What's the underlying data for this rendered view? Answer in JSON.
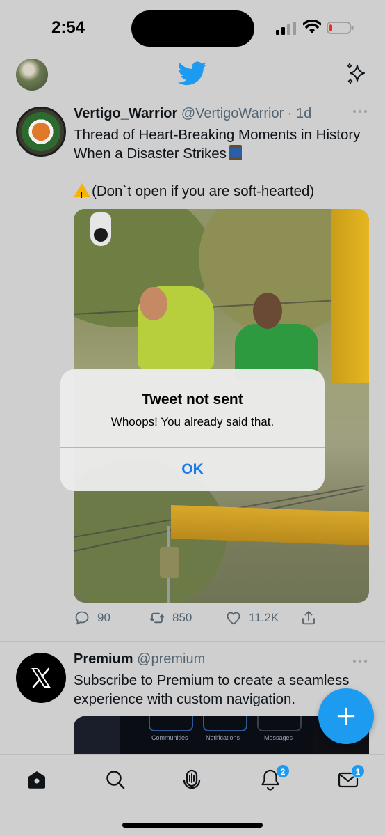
{
  "status_bar": {
    "time": "2:54",
    "battery_level": 0.15,
    "battery_color": "#e0312f"
  },
  "top_nav": {
    "logo_icon": "bird-icon",
    "right_icon": "sparkle-icon",
    "accent_color": "#1d9bf0"
  },
  "tweet": {
    "author_name": "Vertigo_Warrior",
    "author_handle": "@VertigoWarrior",
    "time_sep": " · ",
    "time": "1d",
    "text_line1": "Thread of Heart-Breaking Moments in History When a Disaster Strikes",
    "text_line2": "(Don`t open if you are soft-hearted)",
    "actions": {
      "replies": "90",
      "retweets": "850",
      "likes": "11.2K"
    }
  },
  "promo": {
    "name": "Premium",
    "handle": "@premium",
    "text": "Subscribe to Premium to create a seamless experience with custom navigation.",
    "media_labels": [
      "Communities",
      "Notifications",
      "Messages"
    ]
  },
  "alert": {
    "title": "Tweet not sent",
    "message": "Whoops! You already said that.",
    "ok_label": "OK"
  },
  "tab_bar": {
    "tabs": [
      "home-icon",
      "search-icon",
      "spaces-icon",
      "notifications-icon",
      "messages-icon"
    ],
    "notifications_badge": "2",
    "messages_badge": "1"
  }
}
